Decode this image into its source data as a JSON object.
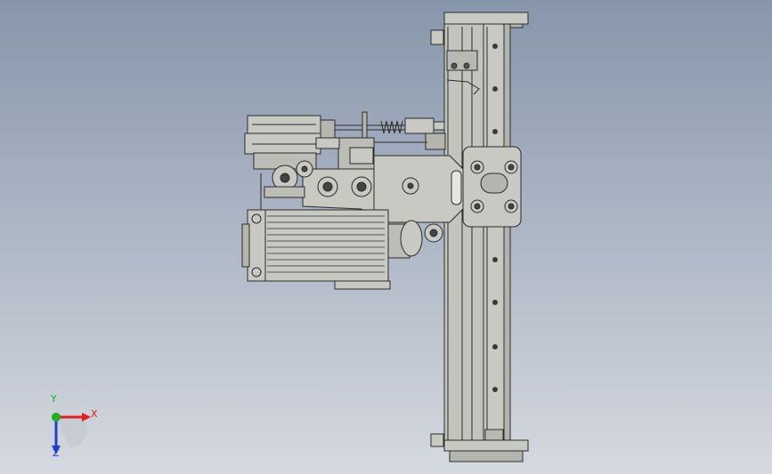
{
  "viewport": {
    "background_top": "#8796ac",
    "background_bottom": "#d5d9e0"
  },
  "model": {
    "part_fill": "#c9c9c3",
    "part_fill_dark": "#a9a9a3",
    "edge_color": "#2b2b2b"
  },
  "triad": {
    "x_label": "X",
    "y_label": "Y",
    "z_label": "Z",
    "x_color": "#e02020",
    "y_color": "#20b020",
    "z_color": "#2040d0"
  }
}
